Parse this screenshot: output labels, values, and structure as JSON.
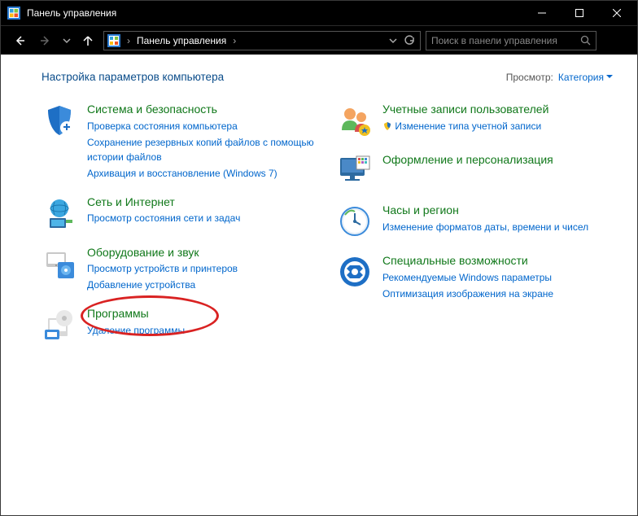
{
  "window": {
    "title": "Панель управления"
  },
  "breadcrumb": {
    "root": "Панель управления"
  },
  "search": {
    "placeholder": "Поиск в панели управления"
  },
  "header": {
    "title": "Настройка параметров компьютера",
    "view_label": "Просмотр:",
    "view_value": "Категория"
  },
  "left": {
    "system": {
      "title": "Система и безопасность",
      "links": [
        "Проверка состояния компьютера",
        "Сохранение резервных копий файлов с помощью истории файлов",
        "Архивация и восстановление (Windows 7)"
      ]
    },
    "network": {
      "title": "Сеть и Интернет",
      "links": [
        "Просмотр состояния сети и задач"
      ]
    },
    "hardware": {
      "title": "Оборудование и звук",
      "links": [
        "Просмотр устройств и принтеров",
        "Добавление устройства"
      ]
    },
    "programs": {
      "title": "Программы",
      "links": [
        "Удаление программы"
      ]
    }
  },
  "right": {
    "accounts": {
      "title": "Учетные записи пользователей",
      "links": [
        "Изменение типа учетной записи"
      ]
    },
    "appearance": {
      "title": "Оформление и персонализация"
    },
    "clock": {
      "title": "Часы и регион",
      "links": [
        "Изменение форматов даты, времени и чисел"
      ]
    },
    "ease": {
      "title": "Специальные возможности",
      "links": [
        "Рекомендуемые Windows параметры",
        "Оптимизация изображения на экране"
      ]
    }
  }
}
